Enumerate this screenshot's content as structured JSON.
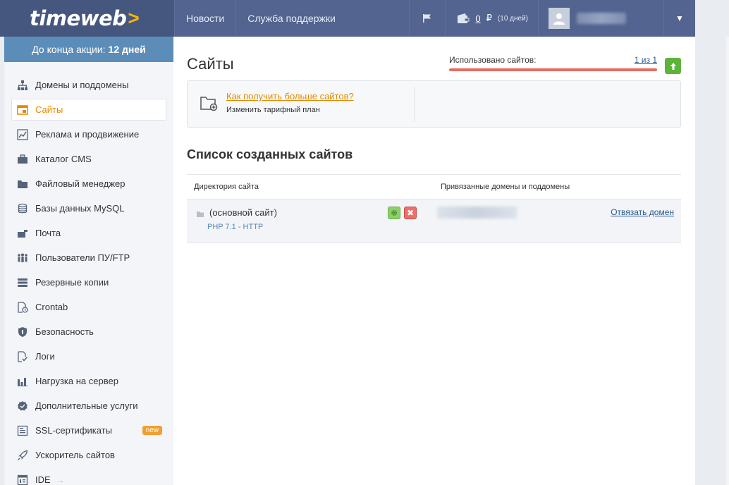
{
  "header": {
    "logo_text": "timeweb",
    "logo_arrow": ">",
    "nav": [
      {
        "label": "Новости"
      },
      {
        "label": "Служба поддержки"
      }
    ],
    "balance_amount": "0",
    "balance_currency": "₽",
    "balance_days": "(10 дней)",
    "dropdown_glyph": "▼"
  },
  "sidebar": {
    "promo_text": "До конца акции:",
    "promo_days": "12 дней",
    "items": [
      {
        "label": "Домены и поддомены",
        "icon": "sitemap-icon"
      },
      {
        "label": "Сайты",
        "icon": "sites-icon",
        "active": true
      },
      {
        "label": "Реклама и продвижение",
        "icon": "chart-icon"
      },
      {
        "label": "Каталог CMS",
        "icon": "cms-icon"
      },
      {
        "label": "Файловый менеджер",
        "icon": "folder-icon"
      },
      {
        "label": "Базы данных MySQL",
        "icon": "database-icon"
      },
      {
        "label": "Почта",
        "icon": "mail-icon"
      },
      {
        "label": "Пользователи ПУ/FTP",
        "icon": "users-icon"
      },
      {
        "label": "Резервные копии",
        "icon": "backup-icon"
      },
      {
        "label": "Crontab",
        "icon": "crontab-icon"
      },
      {
        "label": "Безопасность",
        "icon": "shield-icon"
      },
      {
        "label": "Логи",
        "icon": "logs-icon"
      },
      {
        "label": "Нагрузка на сервер",
        "icon": "bar-chart-icon"
      },
      {
        "label": "Дополнительные услуги",
        "icon": "badge-icon"
      },
      {
        "label": "SSL-сертификаты",
        "icon": "certificate-icon",
        "badge": "new"
      },
      {
        "label": "Ускоритель сайтов",
        "icon": "rocket-icon"
      },
      {
        "label": "IDE",
        "icon": "ide-icon",
        "arrow": "→"
      }
    ]
  },
  "main": {
    "title": "Сайты",
    "usage_label": "Использовано сайтов:",
    "usage_count": "1 из 1",
    "usage_fraction": 1.0,
    "info_link": "Как получить больше сайтов?",
    "info_sub": "Изменить тарифный план",
    "section_title": "Список созданных сайтов",
    "table": {
      "col_dir": "Директория сайта",
      "col_domains": "Привязанные домены и поддомены",
      "rows": [
        {
          "name": "(основной сайт)",
          "php": "PHP 7.1 - HTTP",
          "action": "Отвязать домен",
          "delete_glyph": "✖"
        }
      ]
    }
  },
  "colors": {
    "header_bg": "#52648f",
    "promo_bg": "#5b8db8",
    "accent_orange": "#e08a00",
    "link_blue": "#2a5b8c",
    "usage_bar": "#e96b5e",
    "upgrade_green": "#5db43b"
  }
}
